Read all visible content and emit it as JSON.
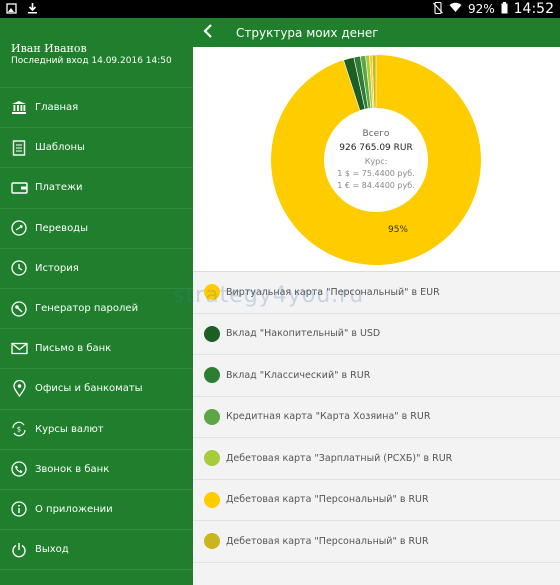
{
  "status_bar": {
    "battery": "92%",
    "time": "14:52"
  },
  "drawer": {
    "user_name": "Иван Иванов",
    "last_login": "Последний вход 14.09.2016 14:50",
    "items": [
      {
        "label": "Главная",
        "icon": "bank-icon"
      },
      {
        "label": "Шаблоны",
        "icon": "document-icon"
      },
      {
        "label": "Платежи",
        "icon": "wallet-icon"
      },
      {
        "label": "Переводы",
        "icon": "transfer-icon"
      },
      {
        "label": "История",
        "icon": "clock-icon"
      },
      {
        "label": "Генератор паролей",
        "icon": "key-icon"
      },
      {
        "label": "Письмо в банк",
        "icon": "envelope-icon"
      },
      {
        "label": "Офисы и банкоматы",
        "icon": "location-pin-icon"
      },
      {
        "label": "Курсы валют",
        "icon": "currency-exchange-icon"
      },
      {
        "label": "Звонок в банк",
        "icon": "phone-icon"
      },
      {
        "label": "О приложении",
        "icon": "info-icon"
      },
      {
        "label": "Выход",
        "icon": "power-icon"
      }
    ]
  },
  "app_bar": {
    "title": "Структура моих денег"
  },
  "chart_center": {
    "total_label": "Всего",
    "total_value": "926 765.09 RUR",
    "rate_label": "Курс:",
    "usd_rate": "1 $ = 75.4400 руб.",
    "eur_rate": "1 € = 84.4400 руб."
  },
  "chart_data": {
    "type": "pie",
    "labels": [
      "Виртуальная карта \"Персональный\" в EUR",
      "Вклад \"Накопительный\" в USD",
      "Вклад \"Классический\" в RUR",
      "Кредитная карта \"Карта Хозяина\" в RUR",
      "Дебетовая карта \"Зарплатный (РСХБ)\" в RUR",
      "Дебетовая карта \"Персональный\" в RUR",
      "Дебетовая карта \"Персональный\" в RUR"
    ],
    "values": [
      0.4,
      1.6,
      1.0,
      0.8,
      0.6,
      95,
      0.6
    ],
    "colors": [
      "#ffcc00",
      "#1d5e24",
      "#2e7d32",
      "#5ea644",
      "#a6cc3c",
      "#ffcc00",
      "#c9b51e"
    ],
    "slice_label": "95%"
  },
  "accounts": [
    {
      "label": "Виртуальная карта \"Персональный\" в EUR",
      "color": "#ffcc00"
    },
    {
      "label": "Вклад \"Накопительный\" в USD",
      "color": "#1d5e24"
    },
    {
      "label": "Вклад \"Классический\" в RUR",
      "color": "#2e7d32"
    },
    {
      "label": "Кредитная карта \"Карта Хозяина\" в RUR",
      "color": "#5ea644"
    },
    {
      "label": "Дебетовая карта \"Зарплатный (РСХБ)\" в RUR",
      "color": "#a6cc3c"
    },
    {
      "label": "Дебетовая карта \"Персональный\" в RUR",
      "color": "#ffcc00"
    },
    {
      "label": "Дебетовая карта \"Персональный\" в RUR",
      "color": "#c9b51e"
    }
  ],
  "watermark": "strategy4you.ru"
}
